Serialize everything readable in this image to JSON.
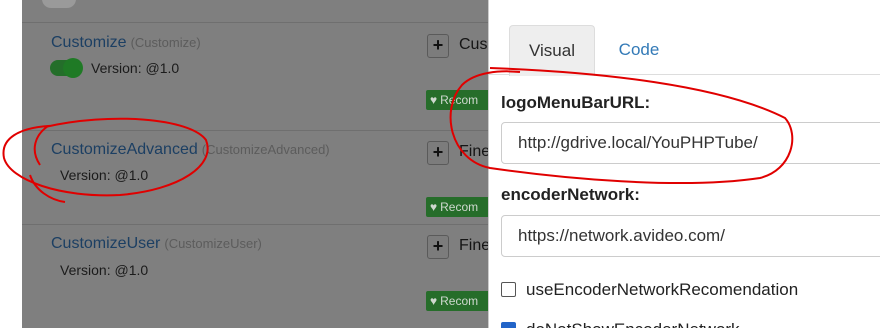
{
  "background_plugins": [
    {
      "name": "Customize",
      "dir": "(Customize)",
      "version": "Version: @1.0",
      "enabled": true,
      "button_label": "Cus",
      "recommend_label": "Recom"
    },
    {
      "name": "CustomizeAdvanced",
      "dir": "(CustomizeAdvanced)",
      "version": "Version: @1.0",
      "button_label": "Fine",
      "recommend_label": "Recom"
    },
    {
      "name": "CustomizeUser",
      "dir": "(CustomizeUser)",
      "version": "Version: @1.0",
      "button_label": "Fine",
      "recommend_label": "Recom"
    }
  ],
  "modal": {
    "tabs": [
      {
        "label": "Visual",
        "active": true
      },
      {
        "label": "Code",
        "active": false
      }
    ],
    "fields": [
      {
        "label": "logoMenuBarURL:",
        "value": "http://gdrive.local/YouPHPTube/"
      },
      {
        "label": "encoderNetwork:",
        "value": "https://network.avideo.com/"
      }
    ],
    "checkboxes": [
      {
        "label": "useEncoderNetworkRecomendation",
        "checked": false
      },
      {
        "label": "doNotShowEncoderNetwork",
        "checked": true
      }
    ]
  },
  "colors": {
    "overlay": "#7f7f7f",
    "link": "#337ab7",
    "recommend_green": "#266d2a",
    "annotation_red": "#e00000"
  },
  "icons": [
    "plus-icon",
    "heart-icon"
  ]
}
